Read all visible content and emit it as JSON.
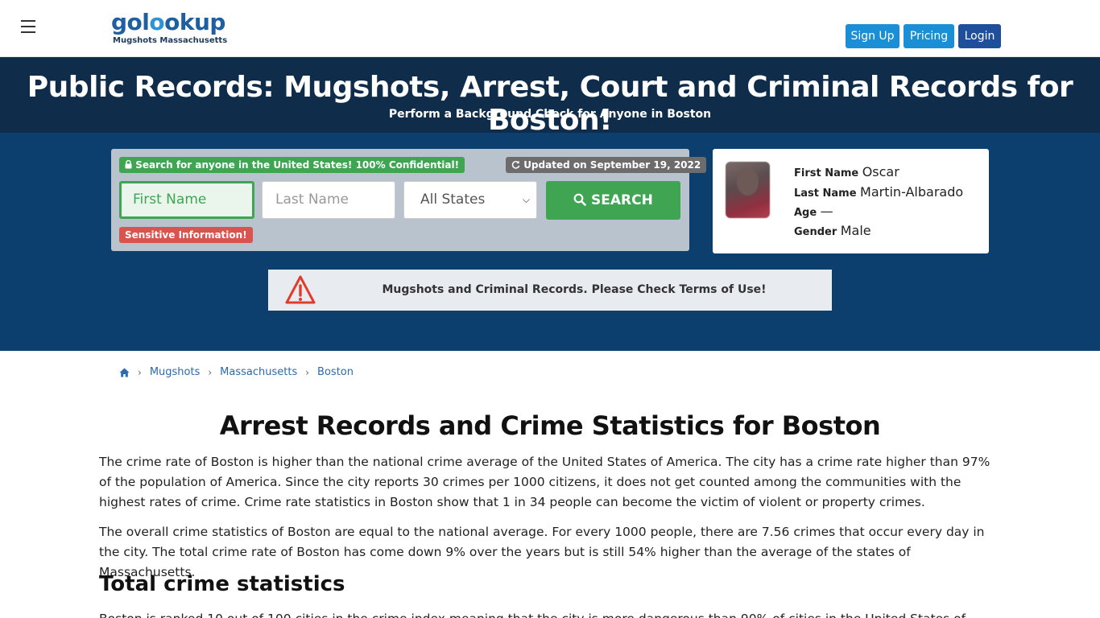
{
  "header": {
    "logo_main_a": "gol",
    "logo_main_b": "o",
    "logo_main_c": "okup",
    "logo_sub": "Mugshots Massachusetts",
    "signup_label": "Sign Up",
    "pricing_label": "Pricing",
    "login_label": "Login"
  },
  "hero": {
    "title": "Public Records: Mugshots, Arrest, Court and Criminal Records for Boston!",
    "subtitle": "Perform a Background Check for Anyone in Boston"
  },
  "search": {
    "confidential_badge": "Search for anyone in the United States! 100% Confidential!",
    "updated_badge": "Updated on September 19, 2022",
    "first_name_placeholder": "First Name",
    "last_name_placeholder": "Last Name",
    "state_selected": "All States",
    "search_label": "SEARCH",
    "sensitive_badge": "Sensitive Information!"
  },
  "person": {
    "first_name_label": "First Name",
    "first_name": "Oscar",
    "last_name_label": "Last Name",
    "last_name": "Martin-Albarado",
    "age_label": "Age",
    "age": "—",
    "gender_label": "Gender",
    "gender": "Male"
  },
  "warning": {
    "text": "Mugshots and Criminal Records. Please Check Terms of Use!"
  },
  "breadcrumb": {
    "items": [
      "Mugshots",
      "Massachusetts",
      "Boston"
    ]
  },
  "article": {
    "title": "Arrest Records and Crime Statistics for Boston",
    "p1": "The crime rate of Boston is higher than the national crime average of the United States of America. The city has a crime rate higher than 97% of the population of America. Since the city reports 30 crimes per 1000 citizens, it does not get counted among the communities with the highest rates of crime. Crime rate statistics in Boston show that 1 in 34 people can become the victim of violent or property crimes.",
    "p2": "The overall crime statistics of Boston are equal to the national average. For every 1000 people, there are 7.56 crimes that occur every day in the city. The total crime rate of Boston has come down 9% over the years but is still 54% higher than the average of the states of Massachusetts.",
    "section_title": "Total crime statistics",
    "p3": "Boston is ranked 10 out of 100 cities in the crime index meaning that the city is more dangerous than 90% of cities in the United States of"
  },
  "colors": {
    "dark_band": "#0f2d4a",
    "hero_body": "#0c3f6d",
    "accent_green": "#3fa553",
    "accent_blue": "#1a8fd6",
    "login_blue": "#1f4f9a",
    "warning_red": "#d9534f"
  },
  "icons": [
    "hamburger-icon",
    "lock-icon",
    "refresh-icon",
    "search-icon",
    "warning-icon",
    "home-icon",
    "chevron-right-icon",
    "chevron-down-icon"
  ]
}
